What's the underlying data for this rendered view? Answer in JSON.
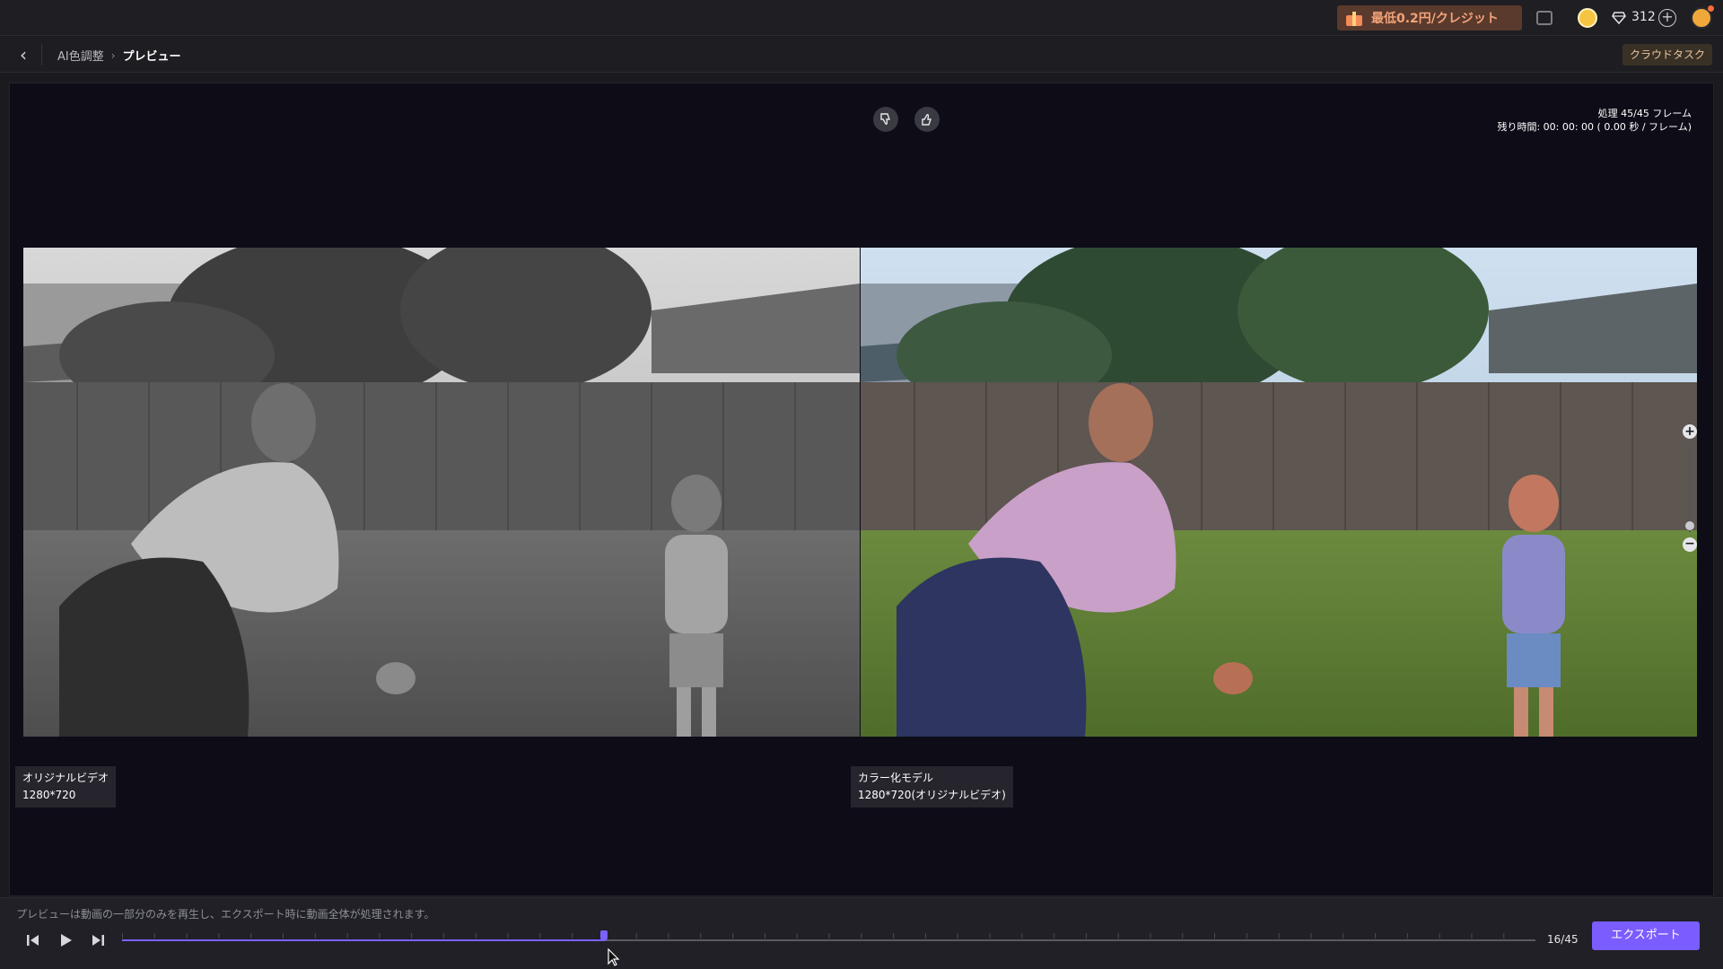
{
  "topbar": {
    "promo_label": "最低0.2円/クレジット",
    "credits": "312",
    "plus": "+",
    "icons": [
      "gift-icon",
      "message-icon",
      "coin-icon",
      "gem-icon",
      "plus-icon",
      "avatar"
    ]
  },
  "nav": {
    "back_icon": "‹",
    "breadcrumb": [
      "AI色調整",
      "プレビュー"
    ],
    "breadcrumb_separator": "›",
    "cloud_task": "クラウドタスク"
  },
  "stage": {
    "progress_line1": "処理 45/45 フレーム",
    "progress_line2": "残り時間: 00: 00: 00 ( 0.00 秒 / フレーム)",
    "zoom_in": "+",
    "zoom_out": "−",
    "left_label_title": "オリジナルビデオ",
    "left_label_res": "1280*720",
    "right_label_title": "カラー化モデル",
    "right_label_res": "1280*720(オリジナルビデオ)"
  },
  "player": {
    "notice": "プレビューは動画の一部分のみを再生し、エクスポート時に動画全体が処理されます。",
    "current_frame": 16,
    "total_frames": 45,
    "frame_count": "16/45",
    "export_label": "エクスポート"
  },
  "colors": {
    "accent": "#7b5cff",
    "promo_bg": "#5a3a2c",
    "promo_text": "#f2a37a",
    "stage_bg": "#0d0c17"
  }
}
